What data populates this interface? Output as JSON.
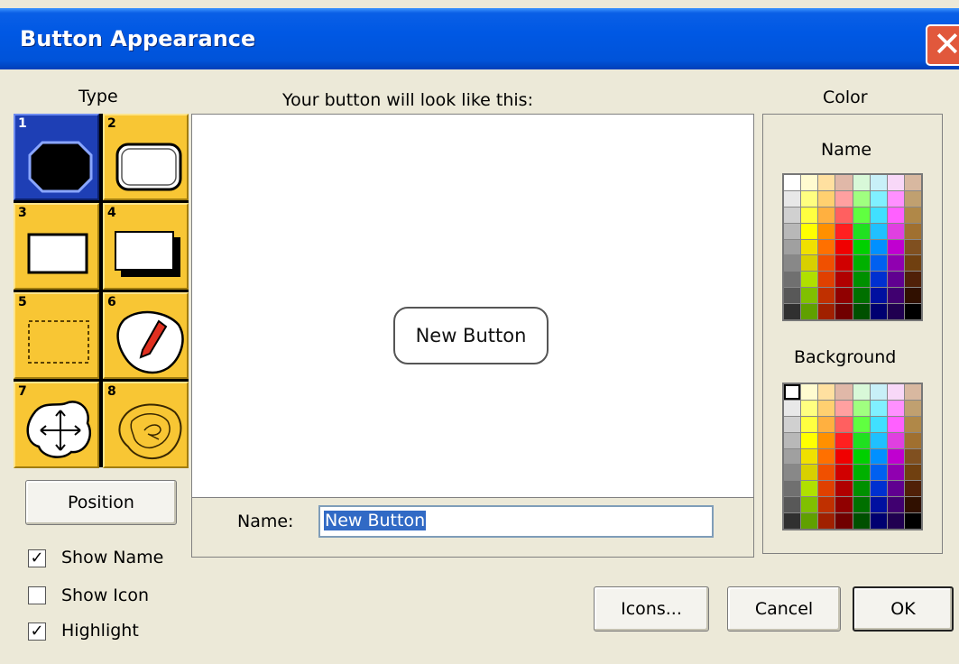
{
  "window": {
    "title": "Button Appearance"
  },
  "type_panel": {
    "label": "Type",
    "cells": [
      {
        "num": "1",
        "selected": true
      },
      {
        "num": "2"
      },
      {
        "num": "3"
      },
      {
        "num": "4"
      },
      {
        "num": "5"
      },
      {
        "num": "6"
      },
      {
        "num": "7"
      },
      {
        "num": "8"
      }
    ]
  },
  "preview": {
    "caption": "Your button will look like this:",
    "button_text": "New Button"
  },
  "name_field": {
    "label": "Name:",
    "value": "New Button"
  },
  "color_panel": {
    "label": "Color",
    "name_label": "Name",
    "background_label": "Background"
  },
  "buttons": {
    "position": "Position",
    "icons": "Icons...",
    "cancel": "Cancel",
    "ok": "OK"
  },
  "checkboxes": [
    {
      "label": "Show Name",
      "checked": true
    },
    {
      "label": "Show Icon",
      "checked": false
    },
    {
      "label": "Highlight",
      "checked": true
    }
  ],
  "palette_colors": [
    [
      "#ffffff",
      "#fffbd0",
      "#ffe0a0",
      "#e0b8a8",
      "#d8f8d8",
      "#c8f0f8",
      "#f8d8f8",
      "#d8b8a0"
    ],
    [
      "#e8e8e8",
      "#ffff80",
      "#ffd070",
      "#ffa0a0",
      "#a0ff80",
      "#80f0ff",
      "#ff90ff",
      "#c0a070"
    ],
    [
      "#d0d0d0",
      "#ffff40",
      "#ffb040",
      "#ff6060",
      "#60ff40",
      "#40e0ff",
      "#ff60ff",
      "#b08848"
    ],
    [
      "#b8b8b8",
      "#ffff00",
      "#ff9000",
      "#ff2020",
      "#20e020",
      "#20c0ff",
      "#e040e0",
      "#a07030"
    ],
    [
      "#a0a0a0",
      "#f0e000",
      "#ff7000",
      "#f00000",
      "#00d000",
      "#0090ff",
      "#c000d0",
      "#805020"
    ],
    [
      "#888888",
      "#d8d000",
      "#f05000",
      "#d00000",
      "#00b000",
      "#0060f0",
      "#9000b0",
      "#704010"
    ],
    [
      "#707070",
      "#b0e000",
      "#e04000",
      "#b00000",
      "#009000",
      "#0030d0",
      "#600090",
      "#502008"
    ],
    [
      "#585858",
      "#80c000",
      "#c03000",
      "#900000",
      "#007000",
      "#0010a0",
      "#400070",
      "#301000"
    ],
    [
      "#303030",
      "#60a000",
      "#a02000",
      "#700000",
      "#005000",
      "#000070",
      "#200050",
      "#000000"
    ]
  ]
}
